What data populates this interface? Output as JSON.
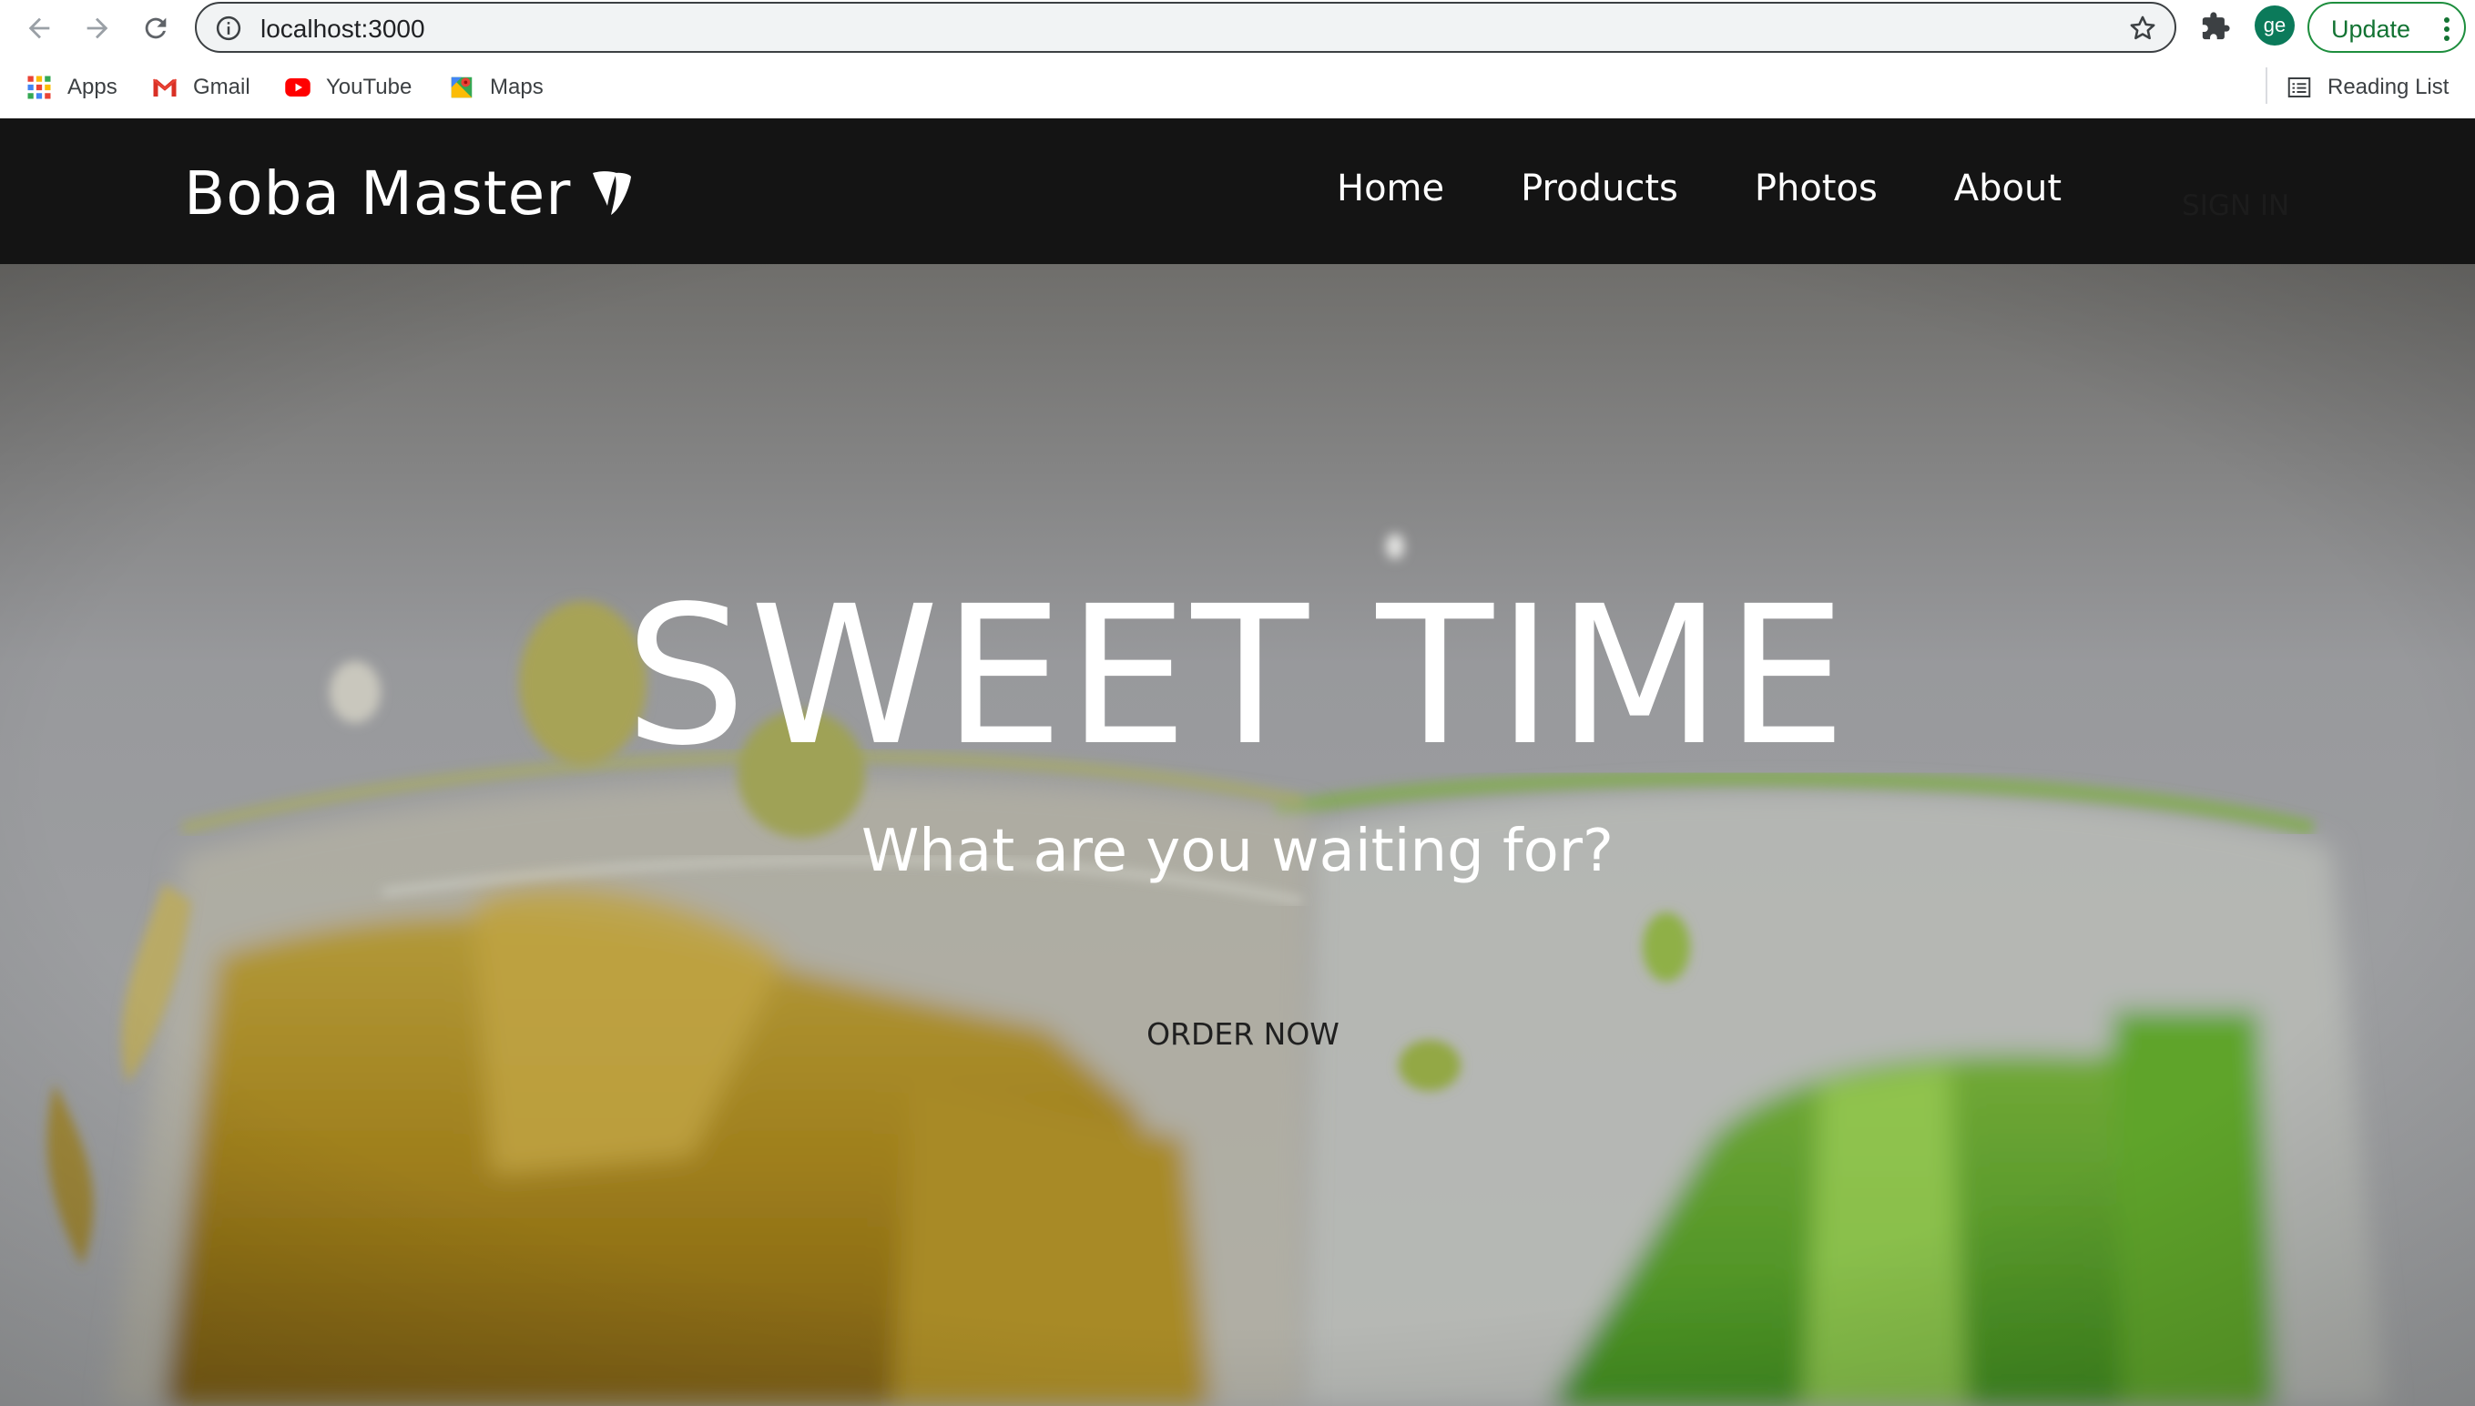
{
  "browser": {
    "url": "localhost:3000",
    "update_label": "Update",
    "profile_initials": "ge",
    "bookmarks": [
      {
        "label": "Apps",
        "icon": "apps-grid-icon"
      },
      {
        "label": "Gmail",
        "icon": "gmail-icon"
      },
      {
        "label": "YouTube",
        "icon": "youtube-icon"
      },
      {
        "label": "Maps",
        "icon": "maps-icon"
      }
    ],
    "reading_list_label": "Reading List"
  },
  "site": {
    "brand": "Boba Master",
    "nav": [
      {
        "label": "Home"
      },
      {
        "label": "Products"
      },
      {
        "label": "Photos"
      },
      {
        "label": "About"
      }
    ],
    "signin_label": "SIGN IN"
  },
  "hero": {
    "title": "SWEET TIME",
    "subtitle": "What are you waiting for?",
    "cta_label": "ORDER NOW"
  },
  "colors": {
    "header_bg": "#141414",
    "update_green": "#1e8e3e",
    "avatar_green": "#0b7a5a"
  }
}
